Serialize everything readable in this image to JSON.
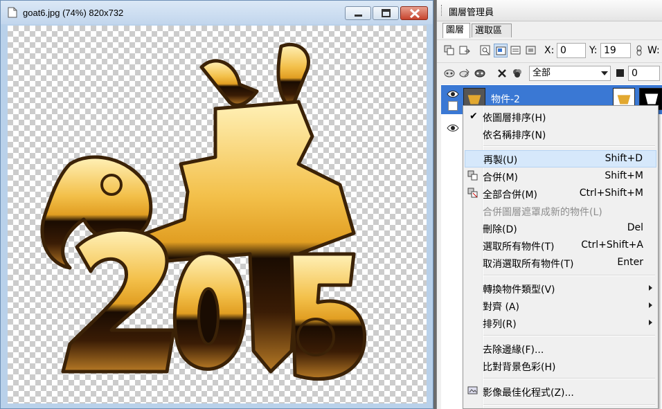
{
  "image_window": {
    "title": "goat6.jpg (74%) 820x732"
  },
  "panel": {
    "title": "圖層管理員",
    "tabs": [
      {
        "label": "圖層",
        "active": true
      },
      {
        "label": "選取區",
        "active": false
      }
    ],
    "x_label": "X:",
    "x_value": "0",
    "y_label": "Y:",
    "y_value": "19",
    "w_label": "W:",
    "filter_value": "全部",
    "opacity_value": "0",
    "layers": [
      {
        "name": "物件-2",
        "selected": true
      },
      {
        "name": "",
        "selected": false
      }
    ]
  },
  "context_menu": {
    "items": [
      {
        "label": "依圖層排序(H)",
        "checked": true
      },
      {
        "label": "依名稱排序(N)"
      },
      {
        "label": "再製(U)",
        "shortcut": "Shift+D",
        "hover": true
      },
      {
        "label": "合併(M)",
        "shortcut": "Shift+M",
        "icon": "merge-icon"
      },
      {
        "label": "全部合併(M)",
        "shortcut": "Ctrl+Shift+M",
        "icon": "merge-all-icon"
      },
      {
        "label": "合併圖層遮罩成新的物件(L)",
        "disabled": true
      },
      {
        "label": "刪除(D)",
        "shortcut": "Del"
      },
      {
        "label": "選取所有物件(T)",
        "shortcut": "Ctrl+Shift+A"
      },
      {
        "label": "取消選取所有物件(T)",
        "shortcut": "Enter"
      },
      {
        "label": "轉換物件類型(V)",
        "submenu": true
      },
      {
        "label": "對齊 (A)",
        "submenu": true
      },
      {
        "label": "排列(R)",
        "submenu": true
      },
      {
        "label": "去除邊緣(F)..."
      },
      {
        "label": "比對背景色彩(H)"
      },
      {
        "label": "影像最佳化程式(Z)...",
        "icon": "image-optimizer-icon"
      }
    ]
  },
  "colors": {
    "selection": "#3a78d4",
    "menu_hover": "#d6e8fb",
    "gold_light": "#f7d87a",
    "gold_dark": "#c58a1c",
    "outline": "#3b2207"
  }
}
